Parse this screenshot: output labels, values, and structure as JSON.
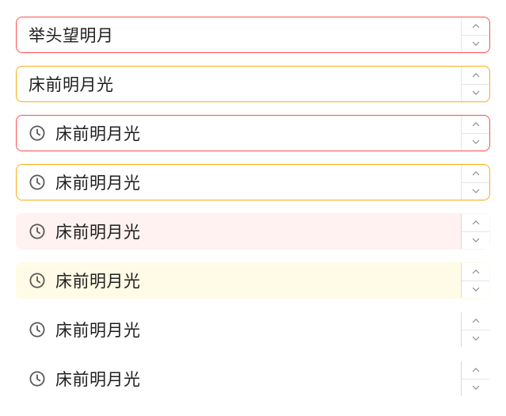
{
  "inputs": [
    {
      "variant": "outlined",
      "status": "error",
      "has_prefix_icon": false,
      "value": "举头望明月"
    },
    {
      "variant": "outlined",
      "status": "warning",
      "has_prefix_icon": false,
      "value": "床前明月光"
    },
    {
      "variant": "outlined",
      "status": "error",
      "has_prefix_icon": true,
      "prefix_icon": "clock-icon",
      "value": "床前明月光"
    },
    {
      "variant": "outlined",
      "status": "warning",
      "has_prefix_icon": true,
      "prefix_icon": "clock-icon",
      "value": "床前明月光"
    },
    {
      "variant": "filled",
      "status": "error",
      "has_prefix_icon": true,
      "prefix_icon": "clock-icon",
      "value": "床前明月光"
    },
    {
      "variant": "filled",
      "status": "warning",
      "has_prefix_icon": true,
      "prefix_icon": "clock-icon",
      "value": "床前明月光"
    },
    {
      "variant": "borderless",
      "status": "error",
      "has_prefix_icon": true,
      "prefix_icon": "clock-icon",
      "value": "床前明月光"
    },
    {
      "variant": "borderless",
      "status": "warning",
      "has_prefix_icon": true,
      "prefix_icon": "clock-icon",
      "value": "床前明月光"
    }
  ],
  "colors": {
    "error_border": "#ff4d4f",
    "warning_border": "#faad14",
    "error_fill": "#fff2f0",
    "warning_fill": "#fffbe6",
    "text": "#1f1f1f",
    "icon": "#595959"
  }
}
